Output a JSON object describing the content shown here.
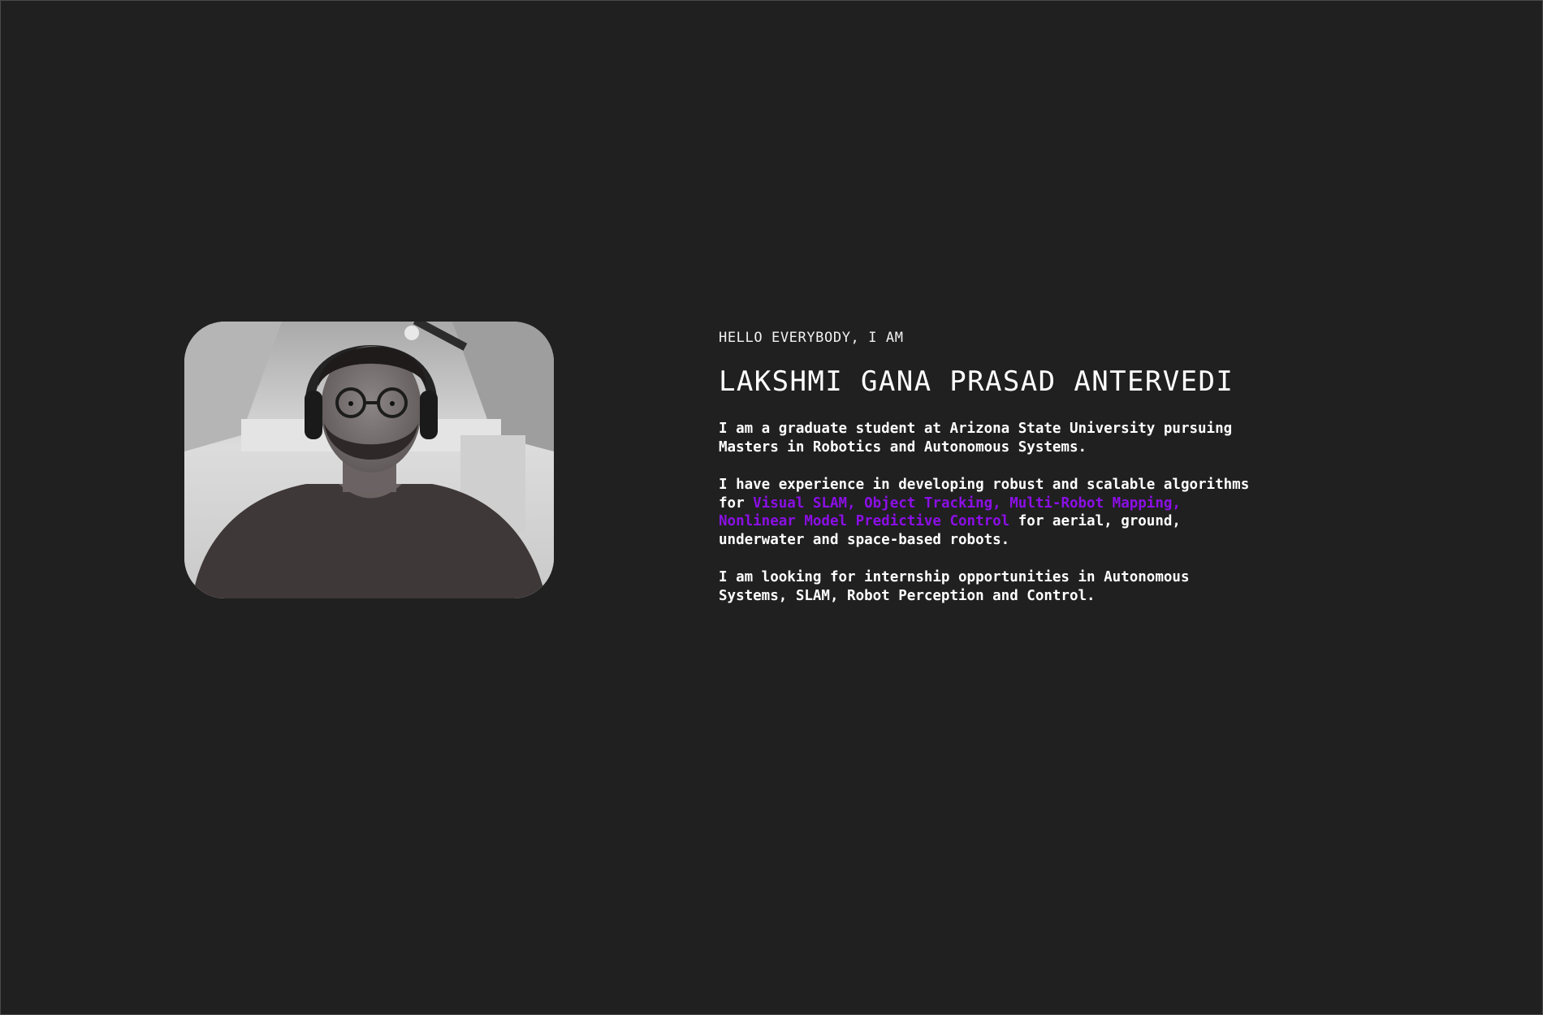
{
  "intro": {
    "greeting": "HELLO EVERYBODY, I AM",
    "name": "LAKSHMI GANA PRASAD ANTERVEDI",
    "para1": "I am a graduate student at Arizona State University pursuing Masters in Robotics and Autonomous Systems.",
    "para2_before": "I have experience in developing robust and scalable algorithms for ",
    "para2_highlight": "Visual SLAM, Object Tracking, Multi-Robot Mapping, Nonlinear Model Predictive Control",
    "para2_after": " for aerial, ground, underwater and space-based robots.",
    "para3": "I am looking for internship opportunities in Autonomous Systems, SLAM, Robot Perception and Control."
  },
  "colors": {
    "background": "#202020",
    "text": "#ffffff",
    "highlight": "#8b0fe6"
  }
}
